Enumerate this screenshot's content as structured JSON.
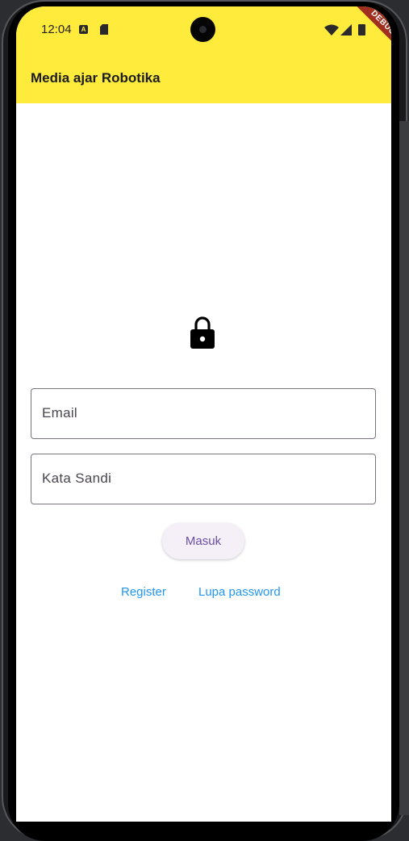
{
  "status_bar": {
    "time": "12:04",
    "icons": [
      "notification-a-icon",
      "sd-card-icon",
      "wifi-icon",
      "signal-icon",
      "battery-icon"
    ],
    "debug_label": "DEBUG"
  },
  "app_bar": {
    "title": "Media ajar Robotika",
    "color": "#ffeb3b"
  },
  "login": {
    "icon": "lock-icon",
    "email_label": "Email",
    "password_label": "Kata Sandi",
    "submit_label": "Masuk",
    "register_label": "Register",
    "forgot_label": "Lupa password"
  },
  "colors": {
    "accent": "#6750a4",
    "link": "#2196f3",
    "debug": "#a02f20"
  }
}
